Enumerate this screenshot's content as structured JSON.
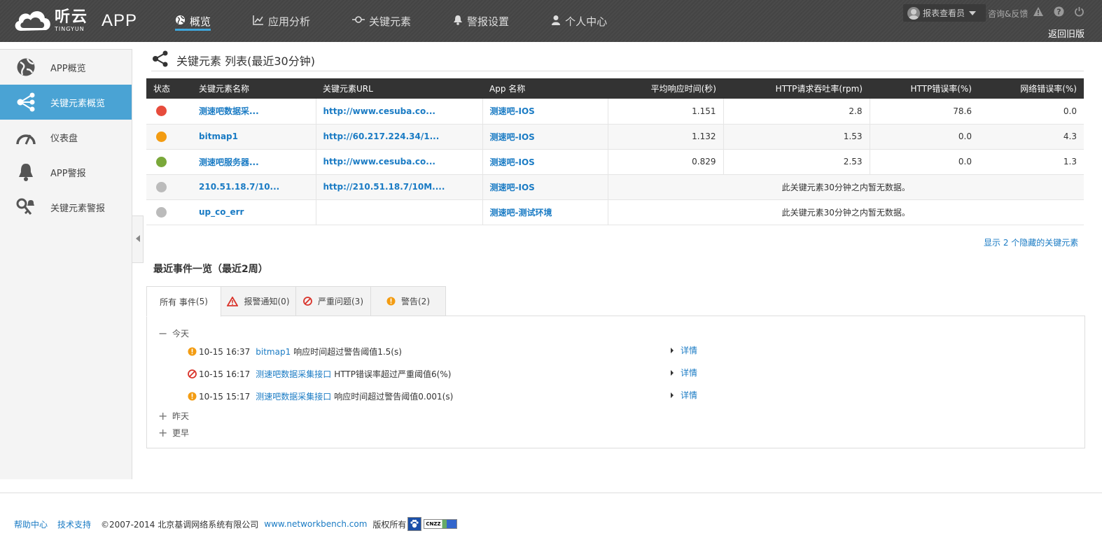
{
  "brand": {
    "logo_cn": "听云",
    "logo_en": "TINGYUN",
    "app_label": "APP"
  },
  "nav": [
    {
      "label": "概览",
      "icon": "globe-icon",
      "active": true
    },
    {
      "label": "应用分析",
      "icon": "chart-icon",
      "active": false
    },
    {
      "label": "关键元素",
      "icon": "key-element-icon",
      "active": false
    },
    {
      "label": "警报设置",
      "icon": "bell-icon",
      "active": false
    },
    {
      "label": "个人中心",
      "icon": "user-icon",
      "active": false
    }
  ],
  "topright": {
    "user": "报表查看员",
    "consult": "咨询&反馈",
    "old_version": "返回旧版"
  },
  "sidebar": [
    {
      "label": "APP概览",
      "icon": "globe-icon",
      "active": false
    },
    {
      "label": "关键元素概览",
      "icon": "share-icon",
      "active": true
    },
    {
      "label": "仪表盘",
      "icon": "gauge-icon",
      "active": false
    },
    {
      "label": "APP警报",
      "icon": "bell-icon",
      "active": false
    },
    {
      "label": "关键元素警报",
      "icon": "key-alarm-icon",
      "active": false
    }
  ],
  "section_title": "关键元素 列表(最近30分钟)",
  "table": {
    "headers": [
      "状态",
      "关键元素名称",
      "关键元素URL",
      "App 名称",
      "平均响应时间(秒)",
      "HTTP请求吞吐率(rpm)",
      "HTTP错误率(%)",
      "网络错误率(%)"
    ],
    "rows": [
      {
        "status": "#e74c3c",
        "name": "测速吧数据采...",
        "url": "http://www.cesuba.co...",
        "app": "测速吧-IOS",
        "resp": "1.151",
        "rpm": "2.8",
        "http_err": "78.6",
        "net_err": "0.0"
      },
      {
        "status": "#f39c12",
        "name": "bitmap1",
        "url": "http://60.217.224.34/1...",
        "app": "测速吧-IOS",
        "resp": "1.132",
        "rpm": "1.53",
        "http_err": "0.0",
        "net_err": "4.3"
      },
      {
        "status": "#7aa83a",
        "name": "测速吧服务器...",
        "url": "http://www.cesuba.co...",
        "app": "测速吧-IOS",
        "resp": "0.829",
        "rpm": "2.53",
        "http_err": "0.0",
        "net_err": "1.3"
      },
      {
        "status": "#bbbbbb",
        "name": "210.51.18.7/10...",
        "url": "http://210.51.18.7/10M....",
        "app": "测速吧-IOS",
        "nodata": "此关键元素30分钟之内暂无数据。"
      },
      {
        "status": "#bbbbbb",
        "name": "up_co_err",
        "url": "",
        "app": "测速吧-测试环境",
        "nodata": "此关键元素30分钟之内暂无数据。"
      }
    ]
  },
  "hidden_link": "显示 2 个隐藏的关键元素",
  "events": {
    "title": "最近事件一览（最近2周）",
    "tabs": [
      {
        "label": "所有 事件",
        "count": "(5)",
        "icon": "",
        "active": true
      },
      {
        "label": "报警通知",
        "count": "(0)",
        "icon": "warning-triangle-icon",
        "active": false
      },
      {
        "label": "严重问题",
        "count": "(3)",
        "icon": "critical-icon",
        "active": false
      },
      {
        "label": "警告",
        "count": "(2)",
        "icon": "warning-circle-icon",
        "active": false
      }
    ],
    "groups": [
      {
        "label": "今天",
        "expanded": true
      },
      {
        "label": "昨天",
        "expanded": false
      },
      {
        "label": "更早",
        "expanded": false
      }
    ],
    "items": [
      {
        "type": "warning",
        "time": "10-15 16:37",
        "element": "bitmap1",
        "message": "响应时间超过警告阈值1.5(s)",
        "detail": "详情"
      },
      {
        "type": "critical",
        "time": "10-15 16:17",
        "element": "测速吧数据采集接口",
        "message": "HTTP错误率超过严重阈值6(%)",
        "detail": "详情"
      },
      {
        "type": "warning",
        "time": "10-15 15:17",
        "element": "测速吧数据采集接口",
        "message": "响应时间超过警告阈值0.001(s)",
        "detail": "详情"
      }
    ]
  },
  "footer": {
    "help": "帮助中心",
    "support": "技术支持",
    "copyright": "©2007-2014  北京基调网络系统有限公司",
    "site": "www.networkbench.com",
    "rights": "版权所有",
    "badge_text": "CNZZ"
  },
  "colors": {
    "accent": "#4aa3d4",
    "link": "#1a7bc4",
    "header_bg": "#444444",
    "warning": "#f39c12",
    "critical": "#e74c3c"
  }
}
